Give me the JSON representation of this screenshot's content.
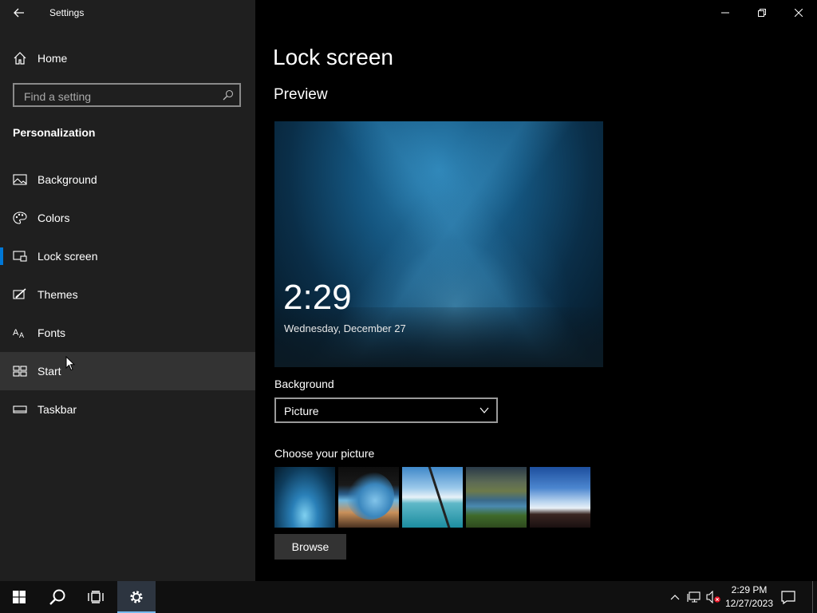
{
  "window": {
    "app_title": "Settings"
  },
  "sidebar": {
    "home_label": "Home",
    "search_placeholder": "Find a setting",
    "section_title": "Personalization",
    "items": [
      {
        "label": "Background",
        "icon": "picture-icon"
      },
      {
        "label": "Colors",
        "icon": "palette-icon"
      },
      {
        "label": "Lock screen",
        "icon": "lock-screen-icon",
        "selected": true
      },
      {
        "label": "Themes",
        "icon": "brush-icon"
      },
      {
        "label": "Fonts",
        "icon": "fonts-icon"
      },
      {
        "label": "Start",
        "icon": "start-tiles-icon",
        "hovered": true
      },
      {
        "label": "Taskbar",
        "icon": "taskbar-icon"
      }
    ]
  },
  "main": {
    "page_title": "Lock screen",
    "preview_title": "Preview",
    "preview_time": "2:29",
    "preview_date": "Wednesday, December 27",
    "background_label": "Background",
    "background_value": "Picture",
    "choose_picture_label": "Choose your picture",
    "browse_label": "Browse"
  },
  "taskbar": {
    "clock_time": "2:29 PM",
    "clock_date": "12/27/2023"
  },
  "colors": {
    "accent": "#0078d7",
    "sidebar_bg": "#1f1f1f",
    "main_bg": "#000000"
  }
}
